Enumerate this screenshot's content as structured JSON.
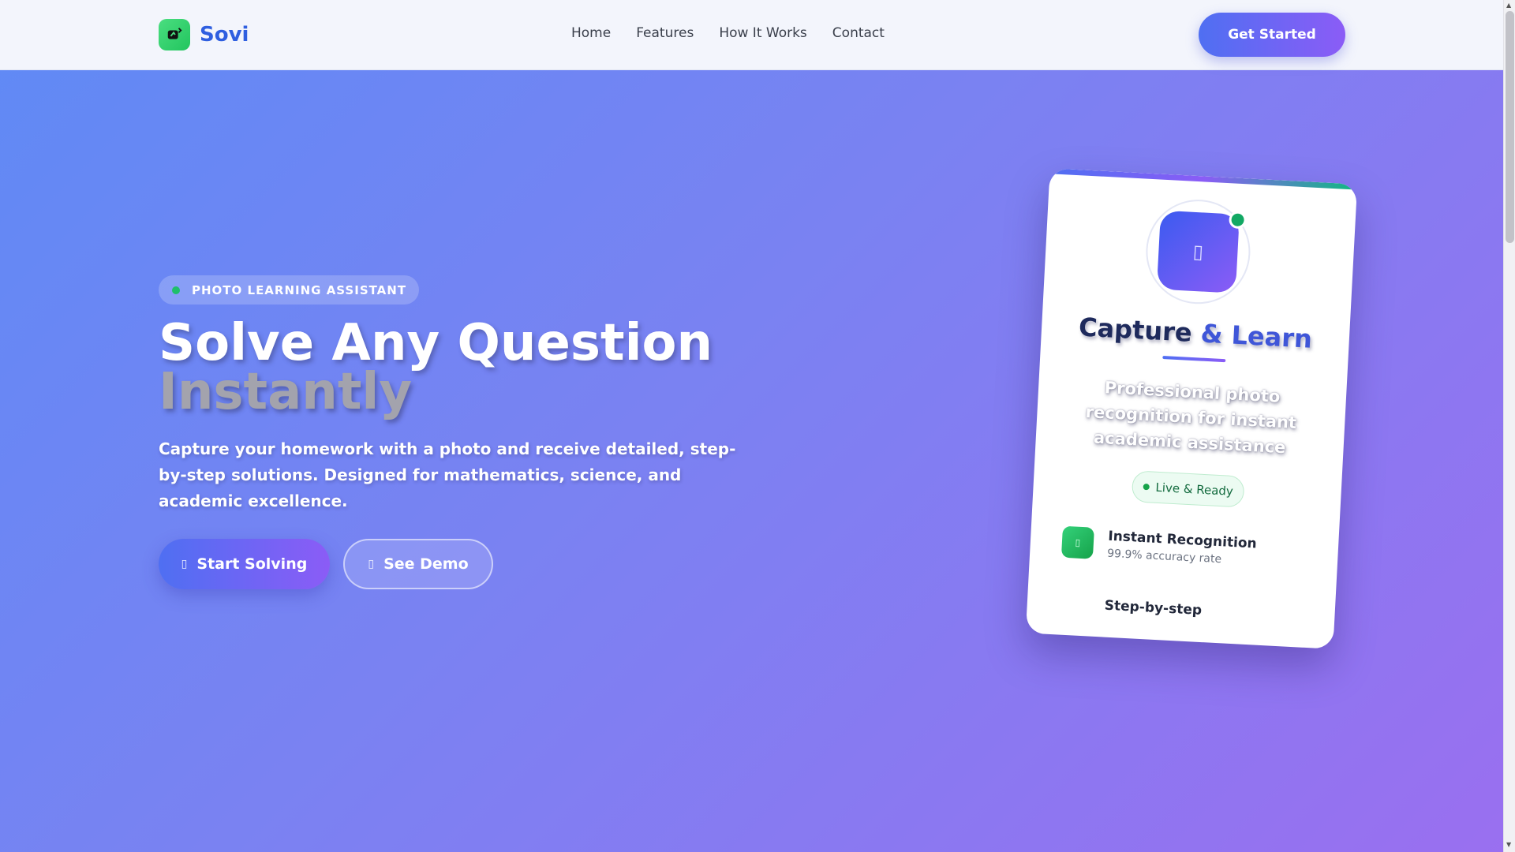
{
  "brand": {
    "name": "Sovi",
    "logo_icon": "camera-refresh-icon",
    "accent": "#2f5fe0",
    "logo_color": "#22c55e"
  },
  "nav": {
    "links": [
      "Home",
      "Features",
      "How It Works",
      "Contact"
    ],
    "cta_label": "Get Started"
  },
  "hero": {
    "badge": "PHOTO LEARNING ASSISTANT",
    "title_line1": "Solve Any Question",
    "title_line2": "Instantly",
    "description": "Capture your homework with a photo and receive detailed, step-by-step solutions. Designed for mathematics, science, and academic excellence.",
    "primary_button": {
      "label": "Start Solving",
      "icon": "camera-icon"
    },
    "secondary_button": {
      "label": "See Demo",
      "icon": "play-icon"
    }
  },
  "card": {
    "icon": "camera-icon",
    "title_part1": "Capture ",
    "title_amp": "&",
    "title_part2": " Learn",
    "description": "Professional photo recognition for instant academic assistance",
    "status": "Live & Ready",
    "features": [
      {
        "title": "Instant Recognition",
        "subtitle": "99.9% accuracy rate",
        "icon": "bolt-icon"
      },
      {
        "title": "Step-by-step",
        "subtitle": "",
        "icon": ""
      }
    ]
  },
  "colors": {
    "primary_gradient_start": "#4f6ff2",
    "primary_gradient_end": "#8b5cf6",
    "success": "#16a34a"
  }
}
